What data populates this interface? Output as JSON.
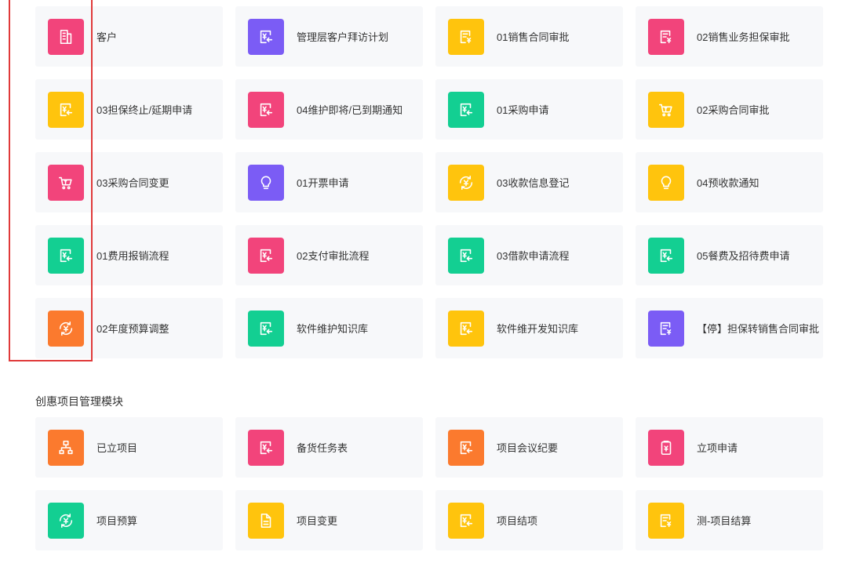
{
  "colors": {
    "pink": "#f2447b",
    "purple": "#7b5cf5",
    "yellow": "#ffc40d",
    "green": "#13cf92",
    "orange": "#fb7a2e",
    "highlight": "#e03a3a"
  },
  "section1": {
    "rows": [
      [
        {
          "label": "客户",
          "icon": "building-icon",
          "color": "pink"
        },
        {
          "label": "管理层客户拜访计划",
          "icon": "yen-doc-icon",
          "color": "purple"
        },
        {
          "label": "01销售合同审批",
          "icon": "form-doc-icon",
          "color": "yellow"
        },
        {
          "label": "02销售业务担保审批",
          "icon": "form-doc-icon",
          "color": "pink"
        }
      ],
      [
        {
          "label": "03担保终止/延期申请",
          "icon": "yen-doc-icon",
          "color": "yellow"
        },
        {
          "label": "04维护即将/已到期通知",
          "icon": "yen-doc-icon",
          "color": "pink"
        },
        {
          "label": "01采购申请",
          "icon": "yen-doc-icon",
          "color": "green"
        },
        {
          "label": "02采购合同审批",
          "icon": "cart-icon",
          "color": "yellow"
        }
      ],
      [
        {
          "label": "03采购合同变更",
          "icon": "cart-icon",
          "color": "pink"
        },
        {
          "label": "01开票申请",
          "icon": "bulb-icon",
          "color": "purple"
        },
        {
          "label": "03收款信息登记",
          "icon": "yen-cycle-icon",
          "color": "yellow"
        },
        {
          "label": "04预收款通知",
          "icon": "bulb-icon",
          "color": "yellow"
        }
      ],
      [
        {
          "label": "01费用报销流程",
          "icon": "yen-doc-icon",
          "color": "green"
        },
        {
          "label": "02支付审批流程",
          "icon": "yen-doc-icon",
          "color": "pink"
        },
        {
          "label": "03借款申请流程",
          "icon": "yen-doc-icon",
          "color": "green"
        },
        {
          "label": "05餐费及招待费申请",
          "icon": "yen-doc-icon",
          "color": "green"
        }
      ],
      [
        {
          "label": "02年度预算调整",
          "icon": "yen-cycle-icon",
          "color": "orange"
        },
        {
          "label": "软件维护知识库",
          "icon": "yen-doc-icon",
          "color": "green"
        },
        {
          "label": "软件维开发知识库",
          "icon": "yen-doc-icon",
          "color": "yellow"
        },
        {
          "label": "【停】担保转销售合同审批",
          "icon": "form-doc-icon",
          "color": "purple"
        }
      ]
    ]
  },
  "section2": {
    "title": "创惠项目管理模块",
    "rows": [
      [
        {
          "label": "已立项目",
          "icon": "org-chart-icon",
          "color": "orange"
        },
        {
          "label": "备货任务表",
          "icon": "yen-doc-icon",
          "color": "pink"
        },
        {
          "label": "项目会议纪要",
          "icon": "yen-doc-icon",
          "color": "orange"
        },
        {
          "label": "立项申请",
          "icon": "clipboard-icon",
          "color": "pink"
        }
      ],
      [
        {
          "label": "项目预算",
          "icon": "yen-cycle-icon",
          "color": "green"
        },
        {
          "label": "项目变更",
          "icon": "file-icon",
          "color": "yellow"
        },
        {
          "label": "项目结项",
          "icon": "yen-doc-icon",
          "color": "yellow"
        },
        {
          "label": "测-项目结算",
          "icon": "form-doc-icon",
          "color": "yellow"
        }
      ]
    ]
  }
}
